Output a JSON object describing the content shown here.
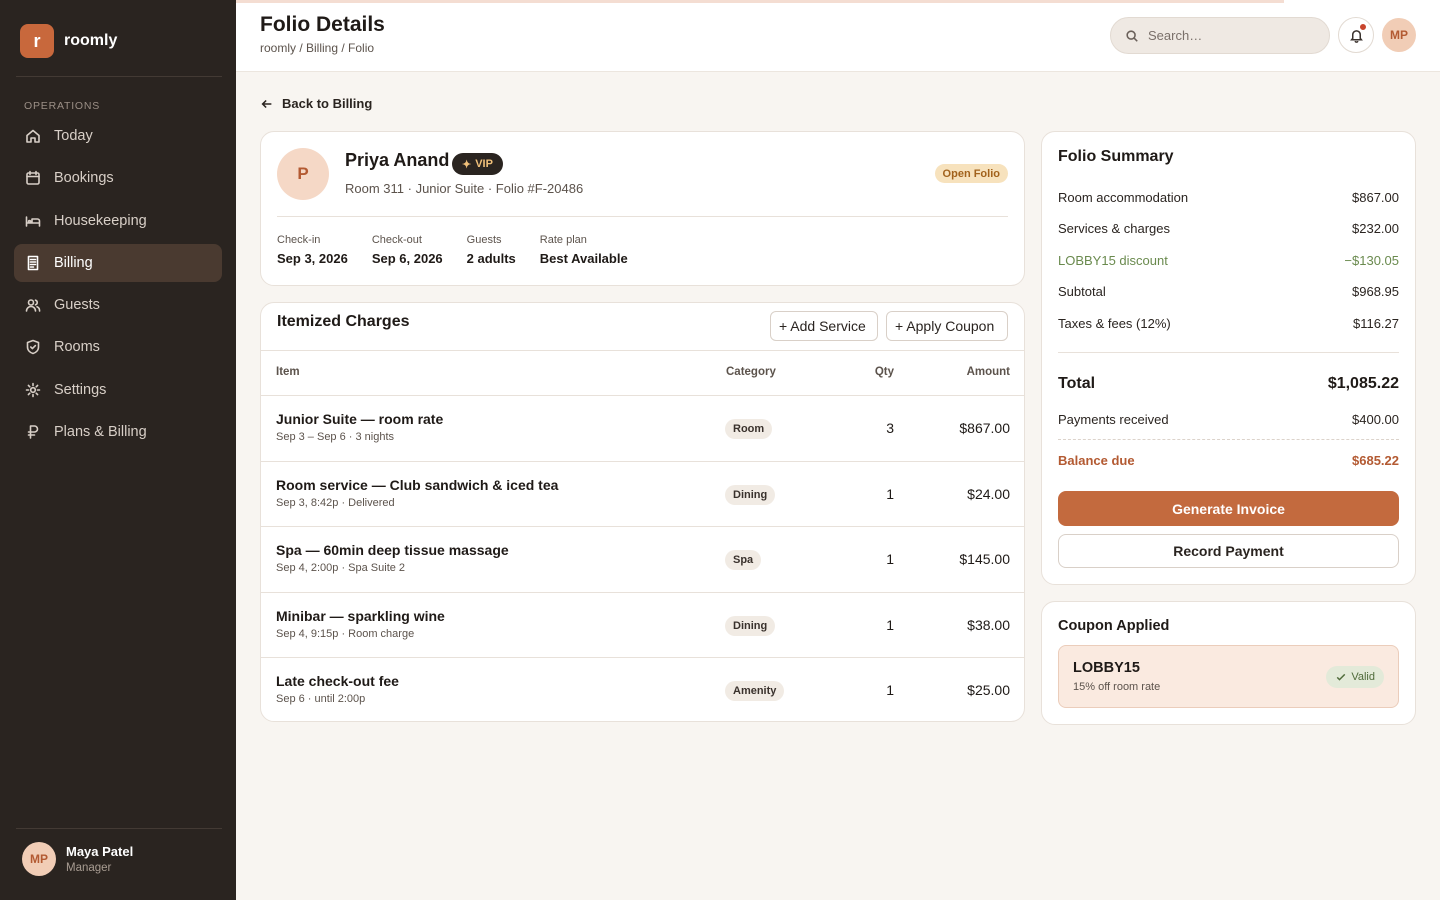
{
  "brand": {
    "logo_letter": "r",
    "name": "roomly"
  },
  "sidebar": {
    "section_label": "OPERATIONS",
    "items": [
      {
        "label": "Today",
        "icon": "home-icon",
        "active": false
      },
      {
        "label": "Bookings",
        "icon": "calendar-icon",
        "active": false
      },
      {
        "label": "Housekeeping",
        "icon": "bed-icon",
        "active": false
      },
      {
        "label": "Billing",
        "icon": "receipt-icon",
        "active": true
      },
      {
        "label": "Guests",
        "icon": "users-icon",
        "active": false
      },
      {
        "label": "Rooms",
        "icon": "shield-icon",
        "active": false
      },
      {
        "label": "Settings",
        "icon": "gear-icon",
        "active": false
      },
      {
        "label": "Plans & Billing",
        "icon": "currency-icon",
        "active": false
      }
    ],
    "user": {
      "initials": "MP",
      "name": "Maya Patel",
      "role": "Manager"
    }
  },
  "header": {
    "title": "Folio Details",
    "breadcrumb": "roomly / Billing / Folio",
    "search_placeholder": "Search…",
    "avatar_initials": "MP"
  },
  "back_link": "Back to Billing",
  "guest": {
    "initial": "P",
    "name": "Priya Anand",
    "vip_label": "VIP",
    "meta": "Room 311 · Junior Suite · Folio #F-20486",
    "status": "Open Folio",
    "stay": [
      {
        "label": "Check-in",
        "value": "Sep 3, 2026"
      },
      {
        "label": "Check-out",
        "value": "Sep 6, 2026"
      },
      {
        "label": "Guests",
        "value": "2 adults"
      },
      {
        "label": "Rate plan",
        "value": "Best Available"
      }
    ]
  },
  "charges": {
    "title": "Itemized Charges",
    "add_service_label": "+ Add Service",
    "apply_coupon_label": "+ Apply Coupon",
    "columns": {
      "item": "Item",
      "category": "Category",
      "qty": "Qty",
      "amount": "Amount"
    },
    "rows": [
      {
        "title": "Junior Suite — room rate",
        "sub": "Sep 3 – Sep 6 · 3 nights",
        "category": "Room",
        "qty": "3",
        "amount": "$867.00"
      },
      {
        "title": "Room service — Club sandwich & iced tea",
        "sub": "Sep 3, 8:42p · Delivered",
        "category": "Dining",
        "qty": "1",
        "amount": "$24.00"
      },
      {
        "title": "Spa — 60min deep tissue massage",
        "sub": "Sep 4, 2:00p · Spa Suite 2",
        "category": "Spa",
        "qty": "1",
        "amount": "$145.00"
      },
      {
        "title": "Minibar — sparkling wine",
        "sub": "Sep 4, 9:15p · Room charge",
        "category": "Dining",
        "qty": "1",
        "amount": "$38.00"
      },
      {
        "title": "Late check-out fee",
        "sub": "Sep 6 · until 2:00p",
        "category": "Amenity",
        "qty": "1",
        "amount": "$25.00"
      }
    ]
  },
  "summary": {
    "title": "Folio Summary",
    "lines": [
      {
        "label": "Room accommodation",
        "value": "$867.00"
      },
      {
        "label": "Services & charges",
        "value": "$232.00"
      },
      {
        "label": "LOBBY15 discount",
        "value": "−$130.05"
      },
      {
        "label": "Subtotal",
        "value": "$968.95"
      },
      {
        "label": "Taxes & fees (12%)",
        "value": "$116.27"
      }
    ],
    "total_label": "Total",
    "total_value": "$1,085.22",
    "payments_label": "Payments received",
    "payments_value": "$400.00",
    "balance_label": "Balance due",
    "balance_value": "$685.22",
    "generate_invoice_label": "Generate Invoice",
    "record_payment_label": "Record Payment"
  },
  "coupon": {
    "title": "Coupon Applied",
    "code": "LOBBY15",
    "description": "15% off room rate",
    "status": "Valid"
  },
  "colors": {
    "accent": "#c36a3e",
    "sidebar_bg": "#2a2420",
    "discount": "#6a8a4e",
    "balance": "#b35a32"
  }
}
